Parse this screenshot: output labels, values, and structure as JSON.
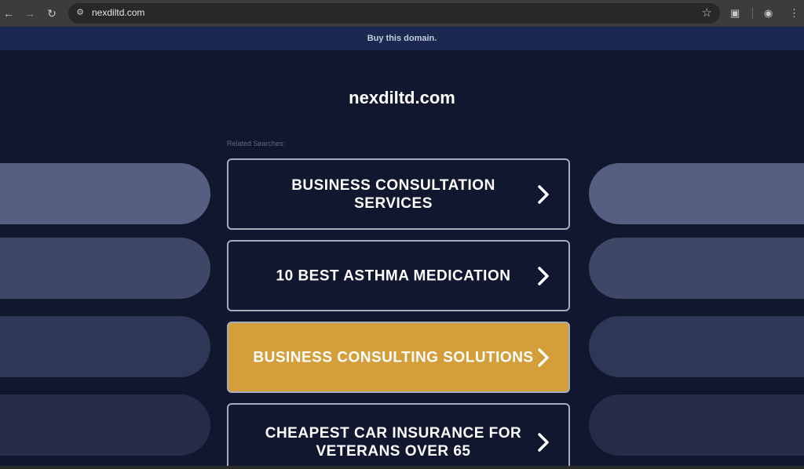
{
  "browser": {
    "url": "nexdiltd.com"
  },
  "banner": {
    "buy_link": "Buy this domain."
  },
  "main": {
    "domain_title": "nexdiltd.com",
    "related_label": "Related Searches:",
    "results": [
      {
        "label": "BUSINESS CONSULTATION SERVICES"
      },
      {
        "label": "10 BEST ASTHMA MEDICATION"
      },
      {
        "label": "BUSINESS CONSULTING SOLUTIONS"
      },
      {
        "label": "CHEAPEST CAR INSURANCE FOR VETERANS OVER 65"
      }
    ]
  },
  "colors": {
    "background": "#11172e",
    "highlight": "#d49e3a",
    "pill_row1": "#565f80",
    "pill_row2": "#3e4766",
    "pill_row3": "#2f3757",
    "pill_row4": "#252c48"
  }
}
